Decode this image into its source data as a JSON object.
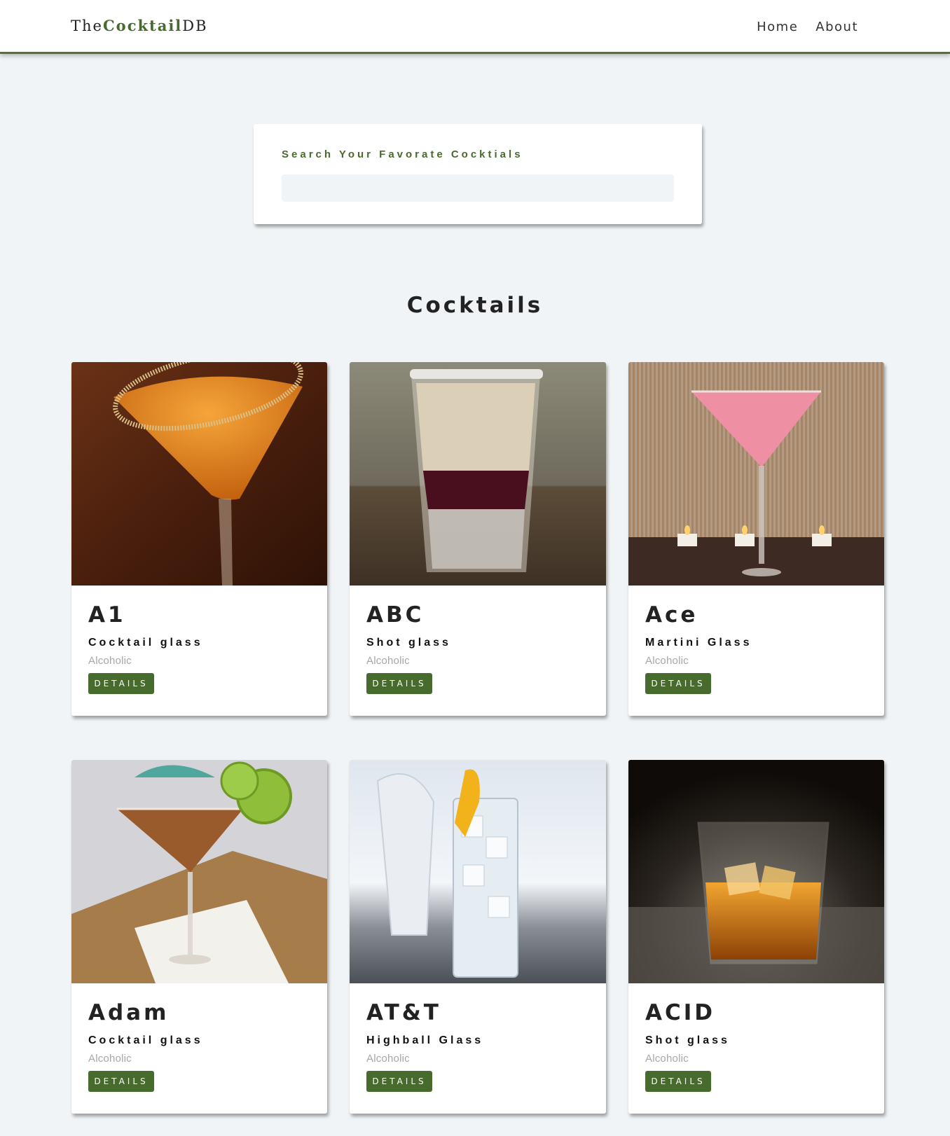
{
  "nav": {
    "logo_prefix": "The",
    "logo_mid": "Cocktail",
    "logo_suffix": "DB",
    "links": [
      "Home",
      "About"
    ]
  },
  "search": {
    "label": "Search Your Favorate Cocktials",
    "value": "",
    "placeholder": ""
  },
  "section_title": "Cocktails",
  "details_label": "DETAILS",
  "cocktails": [
    {
      "name": "A1",
      "glass": "Cocktail glass",
      "info": "Alcoholic"
    },
    {
      "name": "ABC",
      "glass": "Shot glass",
      "info": "Alcoholic"
    },
    {
      "name": "Ace",
      "glass": "Martini Glass",
      "info": "Alcoholic"
    },
    {
      "name": "Adam",
      "glass": "Cocktail glass",
      "info": "Alcoholic"
    },
    {
      "name": "AT&T",
      "glass": "Highball Glass",
      "info": "Alcoholic"
    },
    {
      "name": "ACID",
      "glass": "Shot glass",
      "info": "Alcoholic"
    }
  ],
  "colors": {
    "accent": "#476b2c",
    "background": "#f1f4f6",
    "muted_text": "#a7a7a7"
  }
}
